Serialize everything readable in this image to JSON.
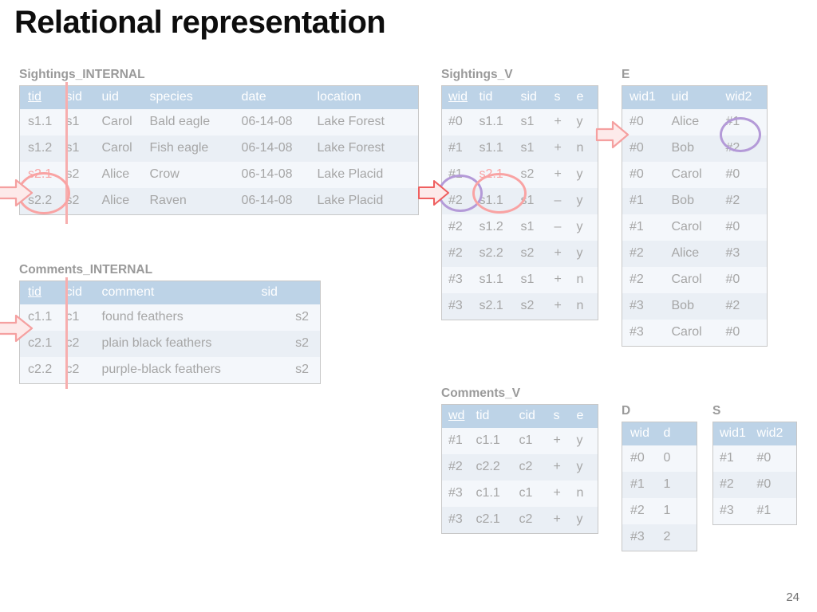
{
  "slide": {
    "title": "Relational representation",
    "page_number": "24"
  },
  "colors": {
    "header_bg": "#bdd3e7",
    "header_text": "#ffffff",
    "cell_text": "#a6a6a6",
    "caption_text": "#9a9a9a",
    "annotation_pink": "#f9a3a3",
    "annotation_purple": "#b49ad8",
    "keyline_pink": "#f7aeae",
    "row_odd": "#f4f7fb",
    "row_even": "#eaeff5",
    "title_text": "#0d0d0d"
  },
  "tables": {
    "sightings_internal": {
      "caption": "Sightings_INTERNAL",
      "key_column": "tid",
      "columns": [
        "tid",
        "sid",
        "uid",
        "species",
        "date",
        "location"
      ],
      "rows": [
        [
          "s1.1",
          "s1",
          "Carol",
          "Bald eagle",
          "06-14-08",
          "Lake Forest"
        ],
        [
          "s1.2",
          "s1",
          "Carol",
          "Fish eagle",
          "06-14-08",
          "Lake Forest"
        ],
        [
          "s2.1",
          "s2",
          "Alice",
          "Crow",
          "06-14-08",
          "Lake Placid"
        ],
        [
          "s2.2",
          "s2",
          "Alice",
          "Raven",
          "06-14-08",
          "Lake Placid"
        ]
      ]
    },
    "comments_internal": {
      "caption": "Comments_INTERNAL",
      "key_column": "tid",
      "columns": [
        "tid",
        "cid",
        "comment",
        "sid"
      ],
      "rows": [
        [
          "c1.1",
          "c1",
          "found feathers",
          "s2"
        ],
        [
          "c2.1",
          "c2",
          "plain black feathers",
          "s2"
        ],
        [
          "c2.2",
          "c2",
          "purple-black feathers",
          "s2"
        ]
      ]
    },
    "sightings_v": {
      "caption": "Sightings_V",
      "key_column": "wid",
      "columns": [
        "wid",
        "tid",
        "sid",
        "s",
        "e"
      ],
      "rows": [
        [
          "#0",
          "s1.1",
          "s1",
          "+",
          "y"
        ],
        [
          "#1",
          "s1.1",
          "s1",
          "+",
          "n"
        ],
        [
          "#1",
          "s2.1",
          "s2",
          "+",
          "y"
        ],
        [
          "#2",
          "s1.1",
          "s1",
          "–",
          "y"
        ],
        [
          "#2",
          "s1.2",
          "s1",
          "–",
          "y"
        ],
        [
          "#2",
          "s2.2",
          "s2",
          "+",
          "y"
        ],
        [
          "#3",
          "s1.1",
          "s1",
          "+",
          "n"
        ],
        [
          "#3",
          "s2.1",
          "s2",
          "+",
          "n"
        ]
      ]
    },
    "comments_v": {
      "caption": "Comments_V",
      "key_column": "wd",
      "columns": [
        "wd",
        "tid",
        "cid",
        "s",
        "e"
      ],
      "rows": [
        [
          "#1",
          "c1.1",
          "c1",
          "+",
          "y"
        ],
        [
          "#2",
          "c2.2",
          "c2",
          "+",
          "y"
        ],
        [
          "#3",
          "c1.1",
          "c1",
          "+",
          "n"
        ],
        [
          "#3",
          "c2.1",
          "c2",
          "+",
          "y"
        ]
      ]
    },
    "e": {
      "caption": "E",
      "columns": [
        "wid1",
        "uid",
        "wid2"
      ],
      "rows": [
        [
          "#0",
          "Alice",
          "#1"
        ],
        [
          "#0",
          "Bob",
          "#2"
        ],
        [
          "#0",
          "Carol",
          "#0"
        ],
        [
          "#1",
          "Bob",
          "#2"
        ],
        [
          "#1",
          "Carol",
          "#0"
        ],
        [
          "#2",
          "Alice",
          "#3"
        ],
        [
          "#2",
          "Carol",
          "#0"
        ],
        [
          "#3",
          "Bob",
          "#2"
        ],
        [
          "#3",
          "Carol",
          "#0"
        ]
      ]
    },
    "d": {
      "caption": "D",
      "columns": [
        "wid",
        "d"
      ],
      "rows": [
        [
          "#0",
          "0"
        ],
        [
          "#1",
          "1"
        ],
        [
          "#2",
          "1"
        ],
        [
          "#3",
          "2"
        ]
      ]
    },
    "s": {
      "caption": "S",
      "columns": [
        "wid1",
        "wid2"
      ],
      "rows": [
        [
          "#1",
          "#0"
        ],
        [
          "#2",
          "#0"
        ],
        [
          "#3",
          "#1"
        ]
      ]
    }
  },
  "annotations": {
    "arrow_sightings_internal": "right-arrow-icon",
    "arrow_comments_internal": "right-arrow-icon",
    "arrow_sightings_v": "right-arrow-icon",
    "arrow_e": "right-arrow-icon",
    "circle_s21_internal": "pink-ellipse-highlight",
    "circle_wid1_sightings_v": "purple-ellipse-highlight",
    "circle_s21_sightings_v": "pink-ellipse-highlight",
    "circle_wid2_e": "purple-ellipse-highlight"
  }
}
